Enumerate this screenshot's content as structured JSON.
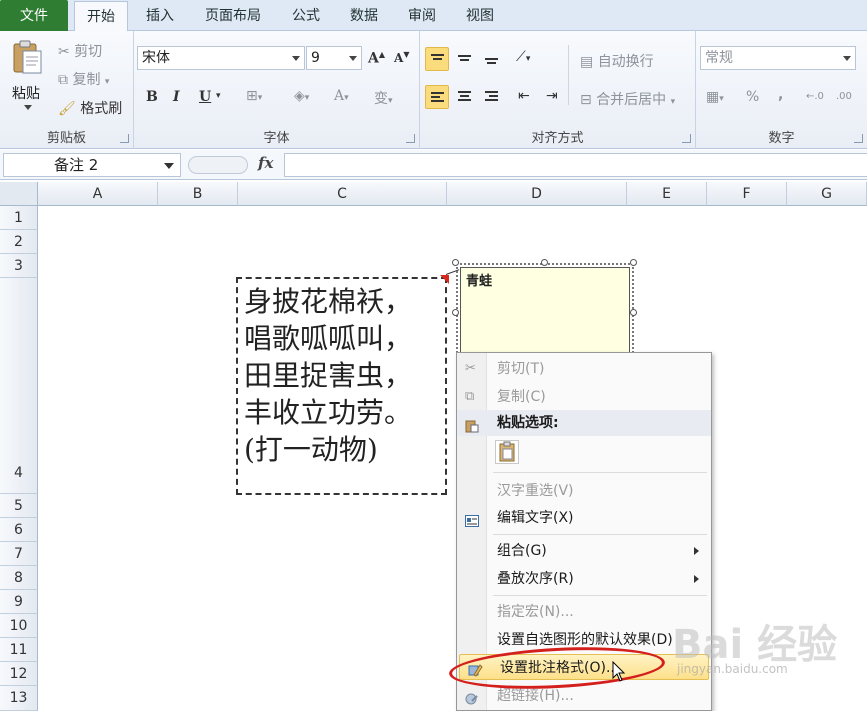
{
  "tabs": [
    "文件",
    "开始",
    "插入",
    "页面布局",
    "公式",
    "数据",
    "审阅",
    "视图"
  ],
  "clipboard": {
    "paste": "粘贴",
    "cut": "剪切",
    "copy": "复制",
    "format_painter": "格式刷",
    "group_label": "剪贴板"
  },
  "font": {
    "name": "宋体",
    "size": "9",
    "bold": "B",
    "italic": "I",
    "underline": "U",
    "group_label": "字体"
  },
  "alignment": {
    "wrap_text": "自动换行",
    "merge_center": "合并后居中",
    "group_label": "对齐方式"
  },
  "number": {
    "format": "常规",
    "percent": "%",
    "comma": ",",
    "group_label": "数字"
  },
  "formula_bar": {
    "name_box": "备注 2",
    "fx": "fx",
    "formula": ""
  },
  "columns": [
    "A",
    "B",
    "C",
    "D",
    "E",
    "F",
    "G"
  ],
  "rows": [
    "1",
    "2",
    "3",
    "4",
    "5",
    "6",
    "7",
    "8",
    "9",
    "10",
    "11",
    "12",
    "13"
  ],
  "textbox": {
    "lines": [
      "身披花棉袄，",
      "唱歌呱呱叫，",
      "田里捉害虫，",
      "丰收立功劳。",
      "(打一动物)"
    ]
  },
  "comment": {
    "author": "青蛙"
  },
  "context_menu": {
    "cut": "剪切(T)",
    "copy": "复制(C)",
    "paste_options": "粘贴选项:",
    "reconvert": "汉字重选(V)",
    "edit_text": "编辑文字(X)",
    "group": "组合(G)",
    "order": "叠放次序(R)",
    "assign_macro": "指定宏(N)...",
    "set_default": "设置自选图形的默认效果(D)",
    "format_comment": "设置批注格式(O)...",
    "hyperlink": "超链接(H)..."
  },
  "watermark": {
    "brand": "Bai 经验",
    "url": "jingyan.baidu.com"
  },
  "colors": {
    "file_tab": "#2f7d32",
    "comment_bg": "#ffffe1",
    "highlight": "#fde08a",
    "oval": "#d3201c"
  }
}
